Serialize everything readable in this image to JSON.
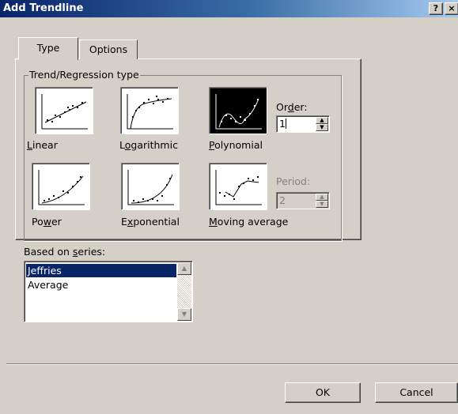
{
  "window": {
    "title": "Add Trendline",
    "help_label": "?",
    "close_label": "×"
  },
  "tabs": [
    {
      "label": "Type",
      "active": true
    },
    {
      "label": "Options",
      "active": false
    }
  ],
  "trend_group": {
    "label": "Trend/Regression type",
    "types": [
      {
        "pre": "",
        "accel": "L",
        "post": "inear",
        "icon": "linear-trend-icon",
        "selected": false
      },
      {
        "pre": "L",
        "accel": "o",
        "post": "garithmic",
        "icon": "logarithmic-trend-icon",
        "selected": false
      },
      {
        "pre": "",
        "accel": "P",
        "post": "olynomial",
        "icon": "polynomial-trend-icon",
        "selected": true
      },
      {
        "pre": "Po",
        "accel": "w",
        "post": "er",
        "icon": "power-trend-icon",
        "selected": false
      },
      {
        "pre": "E",
        "accel": "x",
        "post": "ponential",
        "icon": "exponential-trend-icon",
        "selected": false
      },
      {
        "pre": "",
        "accel": "M",
        "post": "oving average",
        "icon": "moving-average-trend-icon",
        "selected": false
      }
    ],
    "order": {
      "pre": "Or",
      "accel": "d",
      "post": "er:",
      "value": "1"
    },
    "period": {
      "label": "Period:",
      "value": "2",
      "enabled": false
    }
  },
  "series": {
    "pre": "Based on ",
    "accel": "s",
    "post": "eries:",
    "items": [
      {
        "label": "Jeffries",
        "selected": true
      },
      {
        "label": "Average",
        "selected": false
      }
    ]
  },
  "buttons": {
    "ok": "OK",
    "cancel": "Cancel"
  },
  "colors": {
    "titlebar_start": "#0a246a",
    "titlebar_end": "#a6caf0",
    "face": "#d4d0c8",
    "selection": "#0a246a"
  }
}
